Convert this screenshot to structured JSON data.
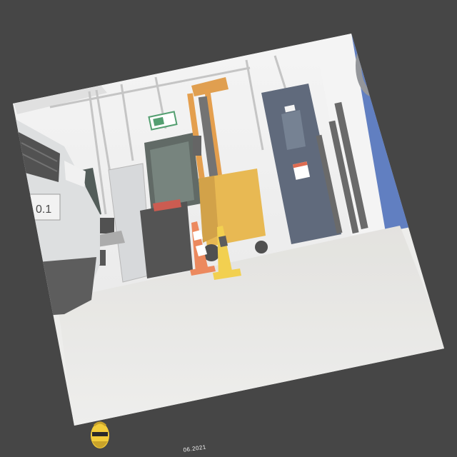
{
  "photo": {
    "description_label": "",
    "caption_date": "06.2021",
    "plate_text": "0.1",
    "colors": {
      "backdrop": "#464646",
      "floor": "#e4e4e2",
      "wall": "#efefef",
      "forklift": "#e3aa2e",
      "door": "#3d4a60",
      "blue_panel": "#3f63b4",
      "cone_orange": "#e8703b",
      "cone_yellow": "#f0c62a"
    },
    "logo_name": "bearded-face-logo"
  }
}
